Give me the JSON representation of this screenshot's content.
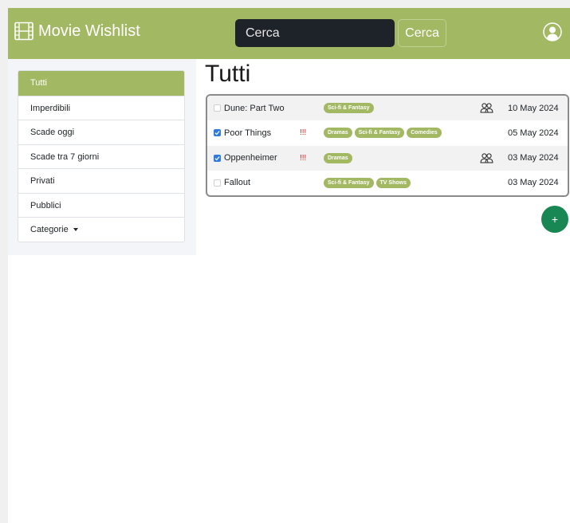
{
  "navbar": {
    "brand": "Movie Wishlist",
    "search_placeholder": "Cerca",
    "search_button": "Cerca"
  },
  "sidebar": {
    "items": [
      {
        "label": "Tutti"
      },
      {
        "label": "Imperdibili"
      },
      {
        "label": "Scade oggi"
      },
      {
        "label": "Scade tra 7 giorni"
      },
      {
        "label": "Privati"
      },
      {
        "label": "Pubblici"
      },
      {
        "label": "Categorie"
      }
    ]
  },
  "main": {
    "title": "Tutti",
    "add_button": "+",
    "films": [
      {
        "title": "Dune: Part Two",
        "checked": false,
        "flag": "",
        "tags": [
          "Sci-fi & Fantasy"
        ],
        "shared": true,
        "date": "10 May 2024"
      },
      {
        "title": "Poor Things",
        "checked": true,
        "flag": "!!!",
        "tags": [
          "Dramas",
          "Sci-fi & Fantasy",
          "Comedies"
        ],
        "shared": false,
        "date": "05 May 2024"
      },
      {
        "title": "Oppenheimer",
        "checked": true,
        "flag": "!!!",
        "tags": [
          "Dramas"
        ],
        "shared": true,
        "date": "03 May 2024"
      },
      {
        "title": "Fallout",
        "checked": false,
        "flag": "",
        "tags": [
          "Sci-fi & Fantasy",
          "TV Shows"
        ],
        "shared": false,
        "date": "03 May 2024"
      }
    ]
  },
  "colors": {
    "navbar": "#a3b863",
    "tag": "#a3b863",
    "add_button": "#198754",
    "checkbox_checked": "#2f7be0",
    "flag": "#e02020"
  }
}
